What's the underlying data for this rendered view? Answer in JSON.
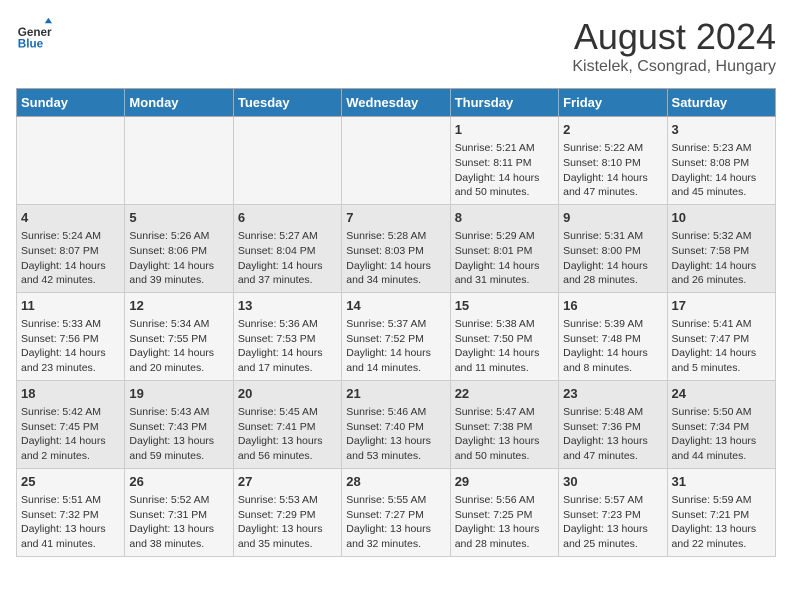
{
  "header": {
    "title": "August 2024",
    "location": "Kistelek, Csongrad, Hungary",
    "logo_general": "General",
    "logo_blue": "Blue"
  },
  "days_of_week": [
    "Sunday",
    "Monday",
    "Tuesday",
    "Wednesday",
    "Thursday",
    "Friday",
    "Saturday"
  ],
  "weeks": [
    [
      {
        "day": "",
        "info": ""
      },
      {
        "day": "",
        "info": ""
      },
      {
        "day": "",
        "info": ""
      },
      {
        "day": "",
        "info": ""
      },
      {
        "day": "1",
        "info": "Sunrise: 5:21 AM\nSunset: 8:11 PM\nDaylight: 14 hours\nand 50 minutes."
      },
      {
        "day": "2",
        "info": "Sunrise: 5:22 AM\nSunset: 8:10 PM\nDaylight: 14 hours\nand 47 minutes."
      },
      {
        "day": "3",
        "info": "Sunrise: 5:23 AM\nSunset: 8:08 PM\nDaylight: 14 hours\nand 45 minutes."
      }
    ],
    [
      {
        "day": "4",
        "info": "Sunrise: 5:24 AM\nSunset: 8:07 PM\nDaylight: 14 hours\nand 42 minutes."
      },
      {
        "day": "5",
        "info": "Sunrise: 5:26 AM\nSunset: 8:06 PM\nDaylight: 14 hours\nand 39 minutes."
      },
      {
        "day": "6",
        "info": "Sunrise: 5:27 AM\nSunset: 8:04 PM\nDaylight: 14 hours\nand 37 minutes."
      },
      {
        "day": "7",
        "info": "Sunrise: 5:28 AM\nSunset: 8:03 PM\nDaylight: 14 hours\nand 34 minutes."
      },
      {
        "day": "8",
        "info": "Sunrise: 5:29 AM\nSunset: 8:01 PM\nDaylight: 14 hours\nand 31 minutes."
      },
      {
        "day": "9",
        "info": "Sunrise: 5:31 AM\nSunset: 8:00 PM\nDaylight: 14 hours\nand 28 minutes."
      },
      {
        "day": "10",
        "info": "Sunrise: 5:32 AM\nSunset: 7:58 PM\nDaylight: 14 hours\nand 26 minutes."
      }
    ],
    [
      {
        "day": "11",
        "info": "Sunrise: 5:33 AM\nSunset: 7:56 PM\nDaylight: 14 hours\nand 23 minutes."
      },
      {
        "day": "12",
        "info": "Sunrise: 5:34 AM\nSunset: 7:55 PM\nDaylight: 14 hours\nand 20 minutes."
      },
      {
        "day": "13",
        "info": "Sunrise: 5:36 AM\nSunset: 7:53 PM\nDaylight: 14 hours\nand 17 minutes."
      },
      {
        "day": "14",
        "info": "Sunrise: 5:37 AM\nSunset: 7:52 PM\nDaylight: 14 hours\nand 14 minutes."
      },
      {
        "day": "15",
        "info": "Sunrise: 5:38 AM\nSunset: 7:50 PM\nDaylight: 14 hours\nand 11 minutes."
      },
      {
        "day": "16",
        "info": "Sunrise: 5:39 AM\nSunset: 7:48 PM\nDaylight: 14 hours\nand 8 minutes."
      },
      {
        "day": "17",
        "info": "Sunrise: 5:41 AM\nSunset: 7:47 PM\nDaylight: 14 hours\nand 5 minutes."
      }
    ],
    [
      {
        "day": "18",
        "info": "Sunrise: 5:42 AM\nSunset: 7:45 PM\nDaylight: 14 hours\nand 2 minutes."
      },
      {
        "day": "19",
        "info": "Sunrise: 5:43 AM\nSunset: 7:43 PM\nDaylight: 13 hours\nand 59 minutes."
      },
      {
        "day": "20",
        "info": "Sunrise: 5:45 AM\nSunset: 7:41 PM\nDaylight: 13 hours\nand 56 minutes."
      },
      {
        "day": "21",
        "info": "Sunrise: 5:46 AM\nSunset: 7:40 PM\nDaylight: 13 hours\nand 53 minutes."
      },
      {
        "day": "22",
        "info": "Sunrise: 5:47 AM\nSunset: 7:38 PM\nDaylight: 13 hours\nand 50 minutes."
      },
      {
        "day": "23",
        "info": "Sunrise: 5:48 AM\nSunset: 7:36 PM\nDaylight: 13 hours\nand 47 minutes."
      },
      {
        "day": "24",
        "info": "Sunrise: 5:50 AM\nSunset: 7:34 PM\nDaylight: 13 hours\nand 44 minutes."
      }
    ],
    [
      {
        "day": "25",
        "info": "Sunrise: 5:51 AM\nSunset: 7:32 PM\nDaylight: 13 hours\nand 41 minutes."
      },
      {
        "day": "26",
        "info": "Sunrise: 5:52 AM\nSunset: 7:31 PM\nDaylight: 13 hours\nand 38 minutes."
      },
      {
        "day": "27",
        "info": "Sunrise: 5:53 AM\nSunset: 7:29 PM\nDaylight: 13 hours\nand 35 minutes."
      },
      {
        "day": "28",
        "info": "Sunrise: 5:55 AM\nSunset: 7:27 PM\nDaylight: 13 hours\nand 32 minutes."
      },
      {
        "day": "29",
        "info": "Sunrise: 5:56 AM\nSunset: 7:25 PM\nDaylight: 13 hours\nand 28 minutes."
      },
      {
        "day": "30",
        "info": "Sunrise: 5:57 AM\nSunset: 7:23 PM\nDaylight: 13 hours\nand 25 minutes."
      },
      {
        "day": "31",
        "info": "Sunrise: 5:59 AM\nSunset: 7:21 PM\nDaylight: 13 hours\nand 22 minutes."
      }
    ]
  ]
}
